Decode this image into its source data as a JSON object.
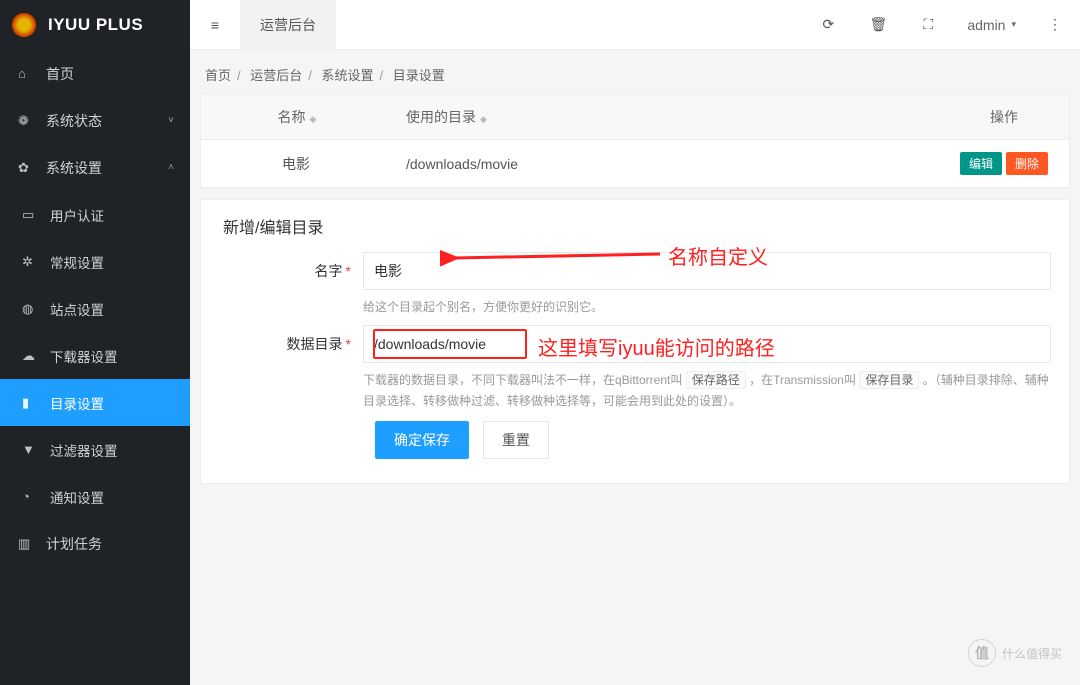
{
  "app": {
    "name": "IYUU PLUS"
  },
  "sidebar": {
    "items": [
      {
        "label": "首页",
        "icon": "⌂"
      },
      {
        "label": "系统状态",
        "icon": "❁",
        "chev": "˅"
      },
      {
        "label": "系统设置",
        "icon": "✿",
        "chev": "˄"
      },
      {
        "label": "用户认证",
        "icon": "▭"
      },
      {
        "label": "常规设置",
        "icon": "✲"
      },
      {
        "label": "站点设置",
        "icon": "◍"
      },
      {
        "label": "下载器设置",
        "icon": "☁"
      },
      {
        "label": "目录设置",
        "icon": "▮"
      },
      {
        "label": "过滤器设置",
        "icon": "▼"
      },
      {
        "label": "通知设置",
        "icon": "◔"
      },
      {
        "label": "计划任务",
        "icon": "▥"
      }
    ]
  },
  "topbar": {
    "toggle": "≡",
    "tab": "运营后台",
    "refresh": "⟳",
    "trash": "🗑",
    "fullscreen": "⛶",
    "user": "admin",
    "more": "⋮"
  },
  "breadcrumb": [
    "首页",
    "运营后台",
    "系统设置",
    "目录设置"
  ],
  "table": {
    "headers": {
      "name": "名称",
      "dir": "使用的目录",
      "action": "操作"
    },
    "row": {
      "name": "电影",
      "dir": "/downloads/movie",
      "edit": "编辑",
      "del": "删除"
    }
  },
  "form": {
    "title": "新增/编辑目录",
    "name_label": "名字",
    "name_value": "电影",
    "name_help": "给这个目录起个别名，方便你更好的识别它。",
    "dir_label": "数据目录",
    "dir_value": "/downloads/movie",
    "dir_help_a": "下载器的数据目录，不同下载器叫法不一样，在qBittorrent叫",
    "dir_help_code1": "保存路径",
    "dir_help_b": "，在Transmission叫",
    "dir_help_code2": "保存目录",
    "dir_help_c": "。（辅种目录排除、辅种目录选择、转移做种过滤、转移做种选择等，可能会用到此处的设置）。",
    "submit": "确定保存",
    "reset": "重置"
  },
  "annot": {
    "a1": "名称自定义",
    "a2": "这里填写iyuu能访问的路径"
  },
  "watermark": "什么值得买"
}
